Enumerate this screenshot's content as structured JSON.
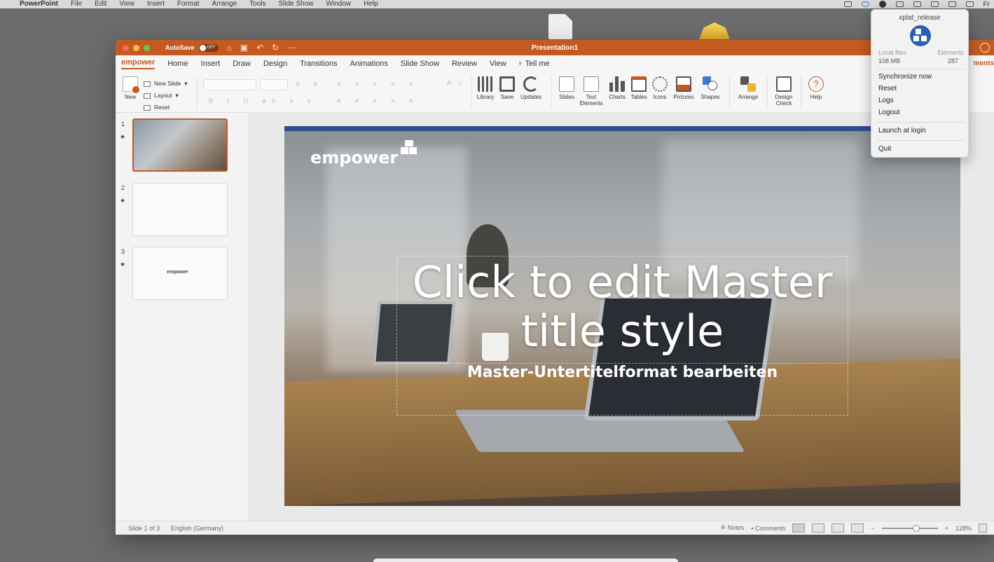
{
  "menubar": {
    "app_name": "PowerPoint",
    "items": [
      "File",
      "Edit",
      "View",
      "Insert",
      "Format",
      "Arrange",
      "Tools",
      "Slide Show",
      "Window",
      "Help"
    ],
    "right_peek": "Fr"
  },
  "window": {
    "title": "Presentation1",
    "autosave_label": "AutoSave",
    "autosave_state": "OFF"
  },
  "tabs": [
    "empower",
    "Home",
    "Insert",
    "Draw",
    "Design",
    "Transitions",
    "Animations",
    "Slide Show",
    "Review",
    "View"
  ],
  "tell_me": "Tell me",
  "comments_peek": "ments",
  "ribbon": {
    "new_label": "New",
    "new_slide": "New Slide",
    "layout": "Layout",
    "reset": "Reset",
    "buttons": [
      {
        "label": "Library",
        "icon": "library-icon"
      },
      {
        "label": "Save",
        "icon": "save-icon"
      },
      {
        "label": "Updates",
        "icon": "updates-icon"
      },
      {
        "label": "Slides",
        "icon": "slides-icon"
      },
      {
        "label": "Text Elements",
        "icon": "text-elements-icon"
      },
      {
        "label": "Charts",
        "icon": "charts-icon"
      },
      {
        "label": "Tables",
        "icon": "tables-icon"
      },
      {
        "label": "Icons",
        "icon": "icons-icon"
      },
      {
        "label": "Pictures",
        "icon": "pictures-icon"
      },
      {
        "label": "Shapes",
        "icon": "shapes-icon"
      },
      {
        "label": "Arrange",
        "icon": "arrange-icon"
      },
      {
        "label": "Design Check",
        "icon": "design-check-icon"
      },
      {
        "label": "Help",
        "icon": "help-icon"
      }
    ]
  },
  "thumbnails": [
    {
      "number": "1",
      "star": "★"
    },
    {
      "number": "2",
      "star": "★"
    },
    {
      "number": "3",
      "star": "★",
      "logo_text": "empower"
    }
  ],
  "slide": {
    "brand": "empower",
    "title": "Click to edit Master title style",
    "subtitle": "Master-Untertitelformat bearbeiten"
  },
  "statusbar": {
    "slide_info": "Slide 1 of 3",
    "language": "English (Germany)",
    "notes": "Notes",
    "comments": "Comments",
    "zoom": "128%",
    "zoom_fraction": 0.62
  },
  "xplat_menu": {
    "title": "xplat_release",
    "col1_label": "Local files",
    "col1_value": "108 MB",
    "col2_label": "Elements",
    "col2_value": "287",
    "items": [
      "Synchronize now",
      "Reset",
      "Logs",
      "Logout",
      "Launch at login",
      "Quit"
    ]
  },
  "colors": {
    "accent": "#c55a21",
    "brand_blue": "#2a5fb2"
  }
}
